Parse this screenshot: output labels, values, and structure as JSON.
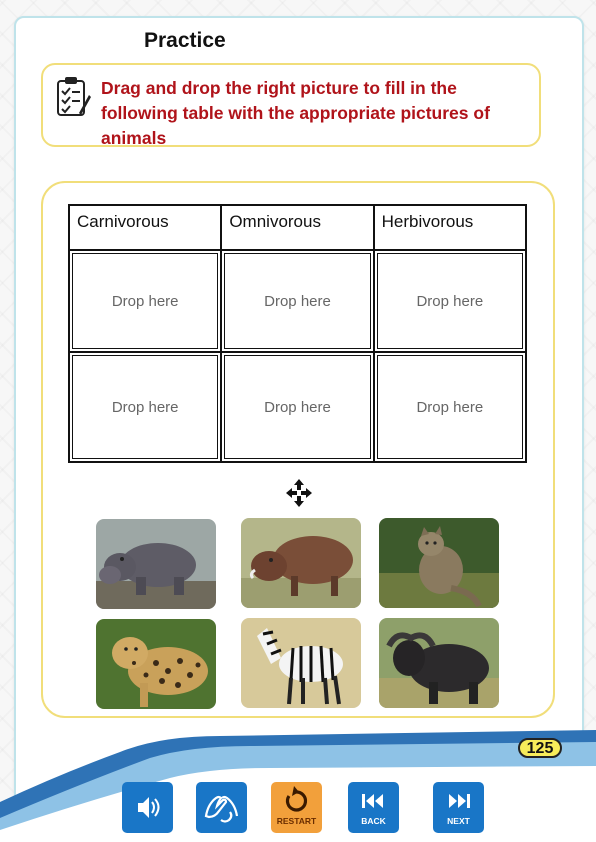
{
  "page": {
    "title": "Practice",
    "page_number": "125"
  },
  "instruction": {
    "text": "Drag and drop the right picture to fill in the following table with the appropriate pictures of animals"
  },
  "table": {
    "headers": [
      "Carnivorous",
      "Omnivorous",
      "Herbivorous"
    ],
    "rows": [
      [
        "Drop here",
        "Drop here",
        "Drop here"
      ],
      [
        "Drop here",
        "Drop here",
        "Drop here"
      ]
    ]
  },
  "pictures": [
    {
      "icon": "hippo-picture"
    },
    {
      "icon": "warthog-picture"
    },
    {
      "icon": "wildcat-picture"
    },
    {
      "icon": "leopard-picture"
    },
    {
      "icon": "zebra-picture"
    },
    {
      "icon": "buffalo-picture"
    }
  ],
  "toolbar": {
    "sound_icon": "speaker-icon",
    "sign_icon": "sign-language-icon",
    "restart_label": "RESTART",
    "back_label": "BACK",
    "next_label": "NEXT"
  },
  "colors": {
    "accent_blue": "#1976c7",
    "restart_orange": "#f2a03b",
    "instruction_red": "#b0131a",
    "border_yellow": "#f1de7a"
  }
}
